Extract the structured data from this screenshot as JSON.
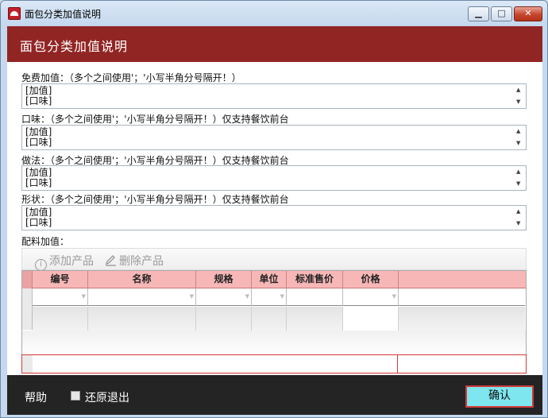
{
  "window": {
    "title": "面包分类加值说明"
  },
  "header": {
    "title": "面包分类加值说明"
  },
  "fields": [
    {
      "label": "免费加值：（多个之间使用'；'小写半角分号隔开！）",
      "value": "[加值]\n[口味]"
    },
    {
      "label": "口味：（多个之间使用'；'小写半角分号隔开！）仅支持餐饮前台",
      "value": "[加值]\n[口味]"
    },
    {
      "label": "做法：（多个之间使用'；'小写半角分号隔开！）仅支持餐饮前台",
      "value": "[加值]\n[口味]"
    },
    {
      "label": "形状：（多个之间使用'；'小写半角分号隔开！）仅支持餐饮前台",
      "value": "[加值]\n[口味]"
    }
  ],
  "ingredients": {
    "label": "配料加值：",
    "toolbar": {
      "add_label": "添加产品",
      "delete_label": "删除产品"
    },
    "columns": [
      "编号",
      "名称",
      "规格",
      "单位",
      "标准售价",
      "价格"
    ]
  },
  "footer": {
    "help_label": "帮助",
    "restore_label": "还原退出",
    "ok_label": "确认"
  },
  "icons": {
    "scroll_up": "▲",
    "scroll_down": "▼",
    "dropdown": "▼",
    "minimize": "▁",
    "maximize": "□",
    "close": "✕"
  },
  "colors": {
    "header_bg": "#912524",
    "footer_bg": "#242424",
    "grid_header_bg": "#f7b7b7",
    "ok_button_bg": "#7de6ee"
  }
}
